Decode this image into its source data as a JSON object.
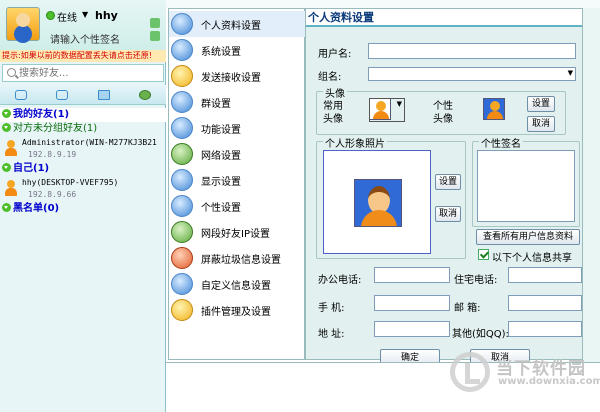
{
  "user": {
    "status": "在线",
    "nickname": "hhy",
    "signature": "请输入个性签名"
  },
  "warning_bar": "提示:如果以前的数据配置丢失请点击还原!",
  "search": {
    "placeholder": "搜索好友..."
  },
  "contacts": {
    "groups": [
      {
        "label": "我的好友(1)"
      },
      {
        "label": "对方未分组好友(1)"
      },
      {
        "label": "自己(1)"
      },
      {
        "label": "黑名单(0)"
      }
    ],
    "items": [
      {
        "name": "Administrator(WIN-M277KJ3B21",
        "ip": "192.8.9.19"
      },
      {
        "name": "hhy(DESKTOP-VVEF795)",
        "ip": "192.8.9.66"
      }
    ]
  },
  "menu": {
    "items": [
      {
        "label": "个人资料设置",
        "icon": "person-icon"
      },
      {
        "label": "系统设置",
        "icon": "system-icon"
      },
      {
        "label": "发送接收设置",
        "icon": "send-receive-icon"
      },
      {
        "label": "群设置",
        "icon": "group-icon"
      },
      {
        "label": "功能设置",
        "icon": "function-icon"
      },
      {
        "label": "网络设置",
        "icon": "network-icon"
      },
      {
        "label": "显示设置",
        "icon": "display-icon"
      },
      {
        "label": "个性设置",
        "icon": "personalize-icon"
      },
      {
        "label": "网段好友IP设置",
        "icon": "ip-icon"
      },
      {
        "label": "屏蔽垃圾信息设置",
        "icon": "block-icon"
      },
      {
        "label": "自定义信息设置",
        "icon": "custom-icon"
      },
      {
        "label": "插件管理及设置",
        "icon": "plugin-icon"
      }
    ]
  },
  "panel": {
    "title": "个人资料设置",
    "username_label": "用户名:",
    "group_label": "组名:",
    "avatar_legend": "头像",
    "common_avatar_label": "常用\n头像",
    "custom_avatar_label": "个性\n头像",
    "set_button": "设置",
    "cancel_button": "取消",
    "photo_legend": "个人形象照片",
    "photo_set_button": "设置",
    "photo_cancel_button": "取消",
    "signature_legend": "个性签名",
    "view_all_button": "查看所有用户信息资料",
    "share_label": "以下个人信息共享",
    "office_phone_label": "办公电话:",
    "home_phone_label": "住宅电话:",
    "mobile_label": "手 机:",
    "email_label": "邮 箱:",
    "address_label": "地 址:",
    "other_label": "其他(如QQ):",
    "ok_button": "确定",
    "cancel_main_button": "取消"
  },
  "watermark": {
    "text": "当下软件园",
    "sub": "www.downxia.com"
  },
  "colors": {
    "accent": "#5fb3c6",
    "group_blue": "#0000cc",
    "warning_red": "#d10000"
  }
}
